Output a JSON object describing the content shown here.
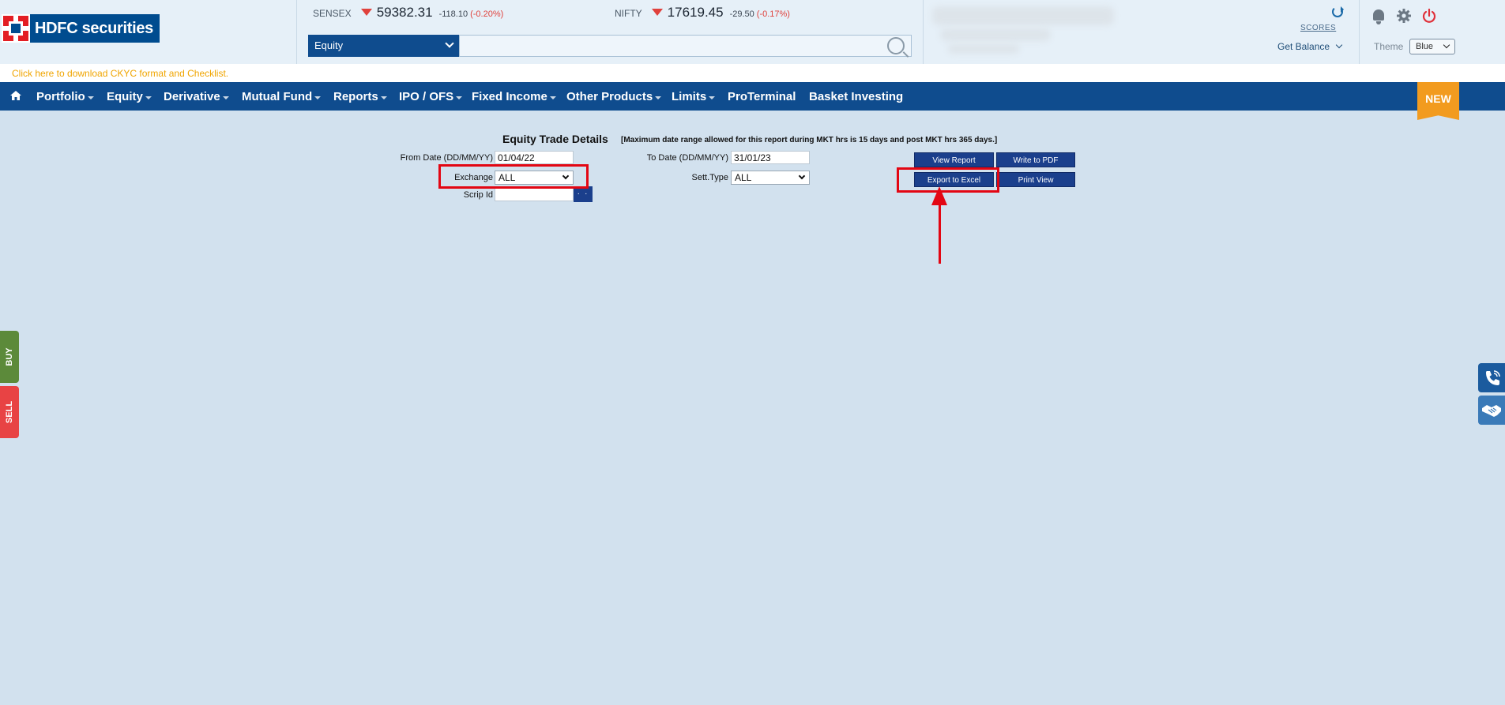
{
  "header": {
    "logo_text": "HDFC securities",
    "tickers": [
      {
        "name": "SENSEX",
        "value": "59382.31",
        "change": "-118.10",
        "percent": "(-0.20%)",
        "direction": "down"
      },
      {
        "name": "NIFTY",
        "value": "17619.45",
        "change": "-29.50",
        "percent": "(-0.17%)",
        "direction": "down"
      }
    ],
    "segment_select": "Equity",
    "search_placeholder": "",
    "scores_label": "SCORES",
    "get_balance_label": "Get Balance",
    "theme_label": "Theme",
    "theme_value": "Blue"
  },
  "notice": {
    "text": "Click here to download CKYC format and Checklist."
  },
  "nav": {
    "items": [
      {
        "label": "Portfolio",
        "dropdown": true
      },
      {
        "label": "Equity",
        "dropdown": true
      },
      {
        "label": "Derivative",
        "dropdown": true
      },
      {
        "label": "Mutual Fund",
        "dropdown": true
      },
      {
        "label": "Reports",
        "dropdown": true
      },
      {
        "label": "IPO / OFS",
        "dropdown": true
      },
      {
        "label": "Fixed Income",
        "dropdown": true
      },
      {
        "label": "Other Products",
        "dropdown": true
      },
      {
        "label": "Limits",
        "dropdown": true
      },
      {
        "label": "ProTerminal",
        "dropdown": false
      },
      {
        "label": "Basket Investing",
        "dropdown": false
      }
    ],
    "new_badge": "NEW"
  },
  "form": {
    "title": "Equity Trade Details",
    "note": "[Maximum date range allowed for this report during MKT hrs is 15 days and post MKT hrs 365 days.]",
    "from_date_label": "From Date (DD/MM/YY)",
    "from_date_value": "01/04/22",
    "to_date_label": "To Date (DD/MM/YY)",
    "to_date_value": "31/01/23",
    "exchange_label": "Exchange",
    "exchange_value": "ALL",
    "sett_type_label": "Sett.Type",
    "sett_type_value": "ALL",
    "scrip_id_label": "Scrip Id",
    "scrip_id_value": "",
    "lookup_label": ". .",
    "buttons": {
      "view_report": "View Report",
      "write_pdf": "Write to PDF",
      "export_excel": "Export to Excel",
      "print_view": "Print View"
    }
  },
  "side": {
    "buy": "BUY",
    "sell": "SELL"
  },
  "colors": {
    "nav_bg": "#0f4c8e",
    "button_bg": "#1b3f8c",
    "highlight": "#e30613",
    "badge": "#f29b1f",
    "page_bg": "#d2e1ee"
  }
}
